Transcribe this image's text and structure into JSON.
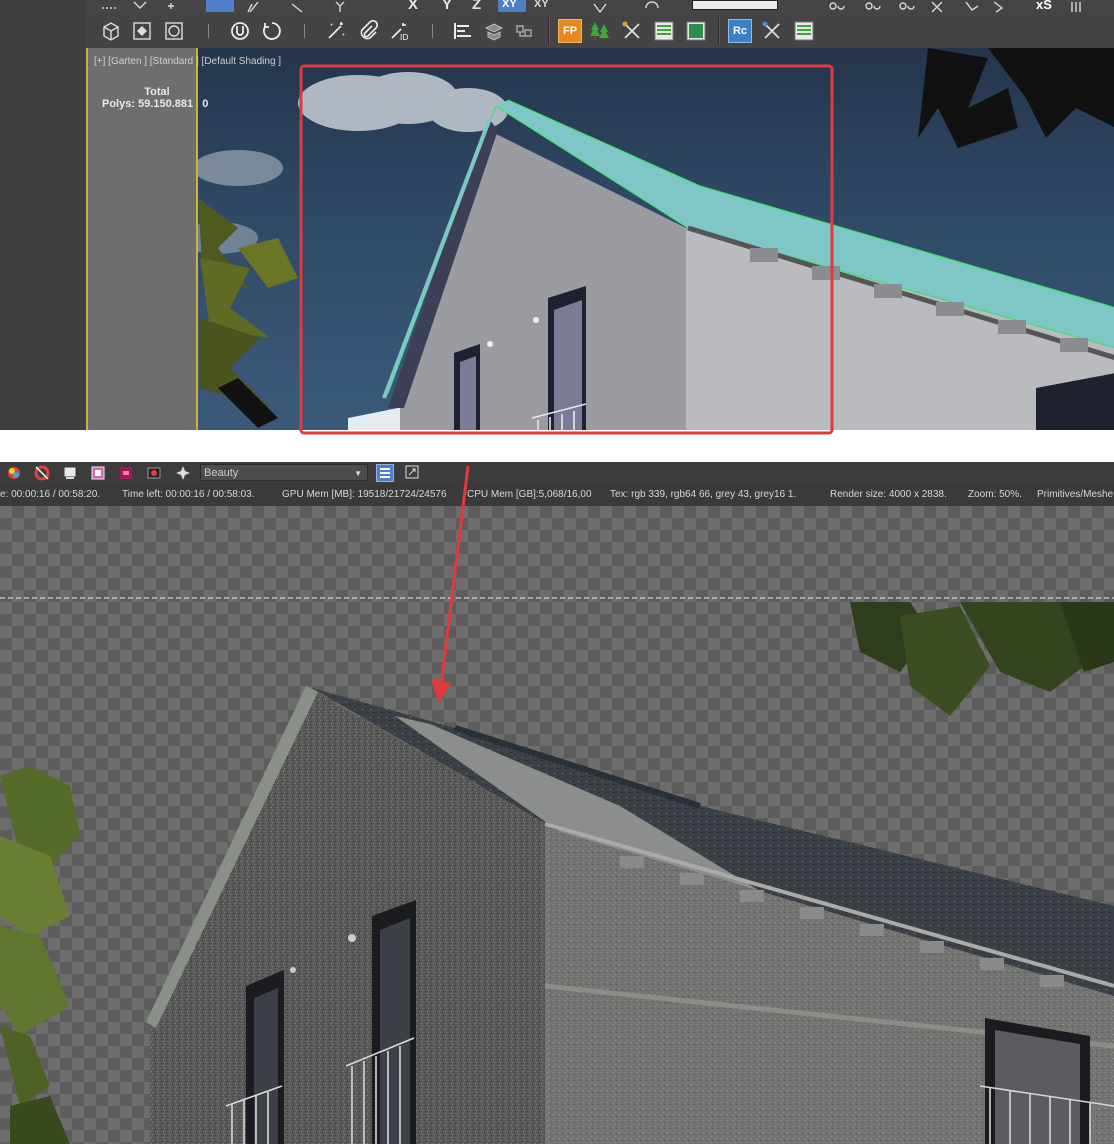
{
  "viewport": {
    "label": "[+] [Garten ] [Standard ] [Default Shading ]",
    "stats_total": "Total",
    "stats_polys_label": "Polys:",
    "stats_polys_value": "59.150.881",
    "stats_polys_selected": "0"
  },
  "toolbar_top": {
    "axis_x": "X",
    "axis_y": "Y",
    "axis_z": "Z",
    "axis_xy": "XY",
    "axis_xy2": "XY",
    "xs_label": "xS"
  },
  "toolbar_main": {
    "plugin_fp": "FP",
    "plugin_rc": "Rc"
  },
  "vfb": {
    "channel": "Beauty",
    "status": {
      "elapsed": "e: 00:00:16 / 00:58:20.",
      "time_left": "Time left: 00:00:16 / 00:58:03.",
      "gpu_mem": "GPU Mem [MB]: 19518/21724/24576",
      "cpu_mem": "CPU Mem [GB]:5,068/16,00",
      "tex": "Tex: rgb 339, rgb64 66, grey 43, grey16 1.",
      "render_size": "Render size: 4000 x 2838.",
      "zoom": "Zoom: 50%.",
      "primitives": "Primitives/Meshe"
    }
  },
  "colors": {
    "annotation_red": "#e23a3a",
    "selection_green": "#3ee26a",
    "viewport_border": "#c9b43a",
    "active_button": "#4f7fc7"
  }
}
